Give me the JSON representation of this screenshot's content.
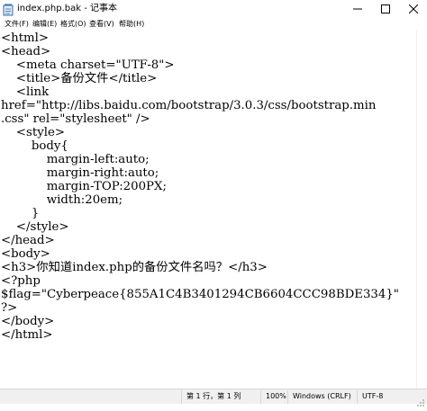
{
  "window": {
    "title": "index.php.bak - 记事本"
  },
  "menu": [
    {
      "label": "文件(F)"
    },
    {
      "label": "编辑(E)"
    },
    {
      "label": "格式(O)"
    },
    {
      "label": "查看(V)"
    },
    {
      "label": "帮助(H)"
    }
  ],
  "editor": {
    "lines": [
      "<html>",
      "<head>",
      "    <meta charset=\"UTF-8\">",
      "    <title>备份文件</title>",
      "    <link",
      "href=\"http://libs.baidu.com/bootstrap/3.0.3/css/bootstrap.min",
      ".css\" rel=\"stylesheet\" />",
      "    <style>",
      "        body{",
      "            margin-left:auto;",
      "            margin-right:auto;",
      "            margin-TOP:200PX;",
      "            width:20em;",
      "        }",
      "    </style>",
      "</head>",
      "<body>",
      "<h3>你知道index.php的备份文件名吗？</h3>",
      "<?php",
      "$flag=\"Cyberpeace{855A1C4B3401294CB6604CCC98BDE334}\"",
      "?>",
      "</body>",
      "</html>"
    ]
  },
  "statusbar": {
    "position": "第 1 行，第 1 列",
    "zoom": "100%",
    "line_ending": "Windows (CRLF)",
    "encoding": "UTF-8"
  },
  "colors": {
    "accent": "#1e88e5",
    "statusbar_bg": "#f0f0f0"
  }
}
